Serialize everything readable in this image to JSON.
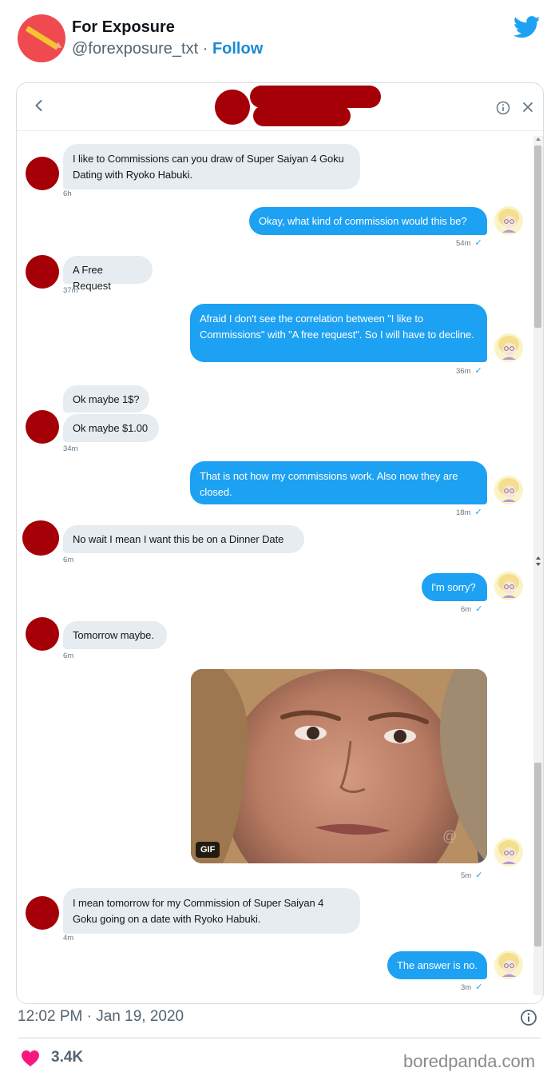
{
  "tweet": {
    "display_name": "For Exposure",
    "handle": "@forexposure_txt",
    "separator": " · ",
    "follow_label": "Follow",
    "timestamp": "12:02 PM · Jan 19, 2020",
    "like_count": "3.4K",
    "watermark": "boredpanda.com"
  },
  "icons": {
    "twitter": "twitter-bird-icon",
    "back": "chevron-left-icon",
    "info": "info-icon",
    "close": "close-icon",
    "heart": "heart-icon",
    "footer_info": "info-icon"
  },
  "colors": {
    "twitter_blue": "#1da1f2",
    "follow_blue": "#1b8ad3",
    "incoming_bubble": "#e6ecf0",
    "redaction_red": "#a50007",
    "heart_pink": "#f91880"
  },
  "conversation": {
    "messages": [
      {
        "direction": "in",
        "text": "I like to Commissions can you draw of Super Saiyan 4 Goku Dating with Ryoko Habuki.",
        "time": "6h"
      },
      {
        "direction": "out",
        "text": "Okay, what kind of commission would this be?",
        "time": "54m",
        "read": true
      },
      {
        "direction": "in",
        "text": "A Free Request",
        "time": "37m"
      },
      {
        "direction": "out",
        "text": "Afraid I don't see the correlation between \"I like to Commissions\" with \"A free request\". So I will have to decline.",
        "time": "36m",
        "read": true
      },
      {
        "direction": "in",
        "text": "Ok maybe 1$?"
      },
      {
        "direction": "in",
        "text": "Ok maybe $1.00",
        "time": "34m"
      },
      {
        "direction": "out",
        "text": "That is not how my commissions work. Also now they are closed.",
        "time": "18m",
        "read": true
      },
      {
        "direction": "in",
        "text": "No wait I mean I want this be on a Dinner Date",
        "time": "6m"
      },
      {
        "direction": "out",
        "text": "I'm sorry?",
        "time": "6m",
        "read": true
      },
      {
        "direction": "in",
        "text": "Tomorrow maybe.",
        "time": "6m"
      },
      {
        "direction": "out",
        "media": "gif",
        "gif_label": "GIF",
        "time": "5m",
        "read": true
      },
      {
        "direction": "in",
        "text": "I mean tomorrow for my Commission of Super Saiyan 4 Goku going on a date with Ryoko Habuki.",
        "time": "4m"
      },
      {
        "direction": "out",
        "text": "The answer is no.",
        "time": "3m",
        "read": true
      }
    ],
    "check_glyph": "✓"
  }
}
